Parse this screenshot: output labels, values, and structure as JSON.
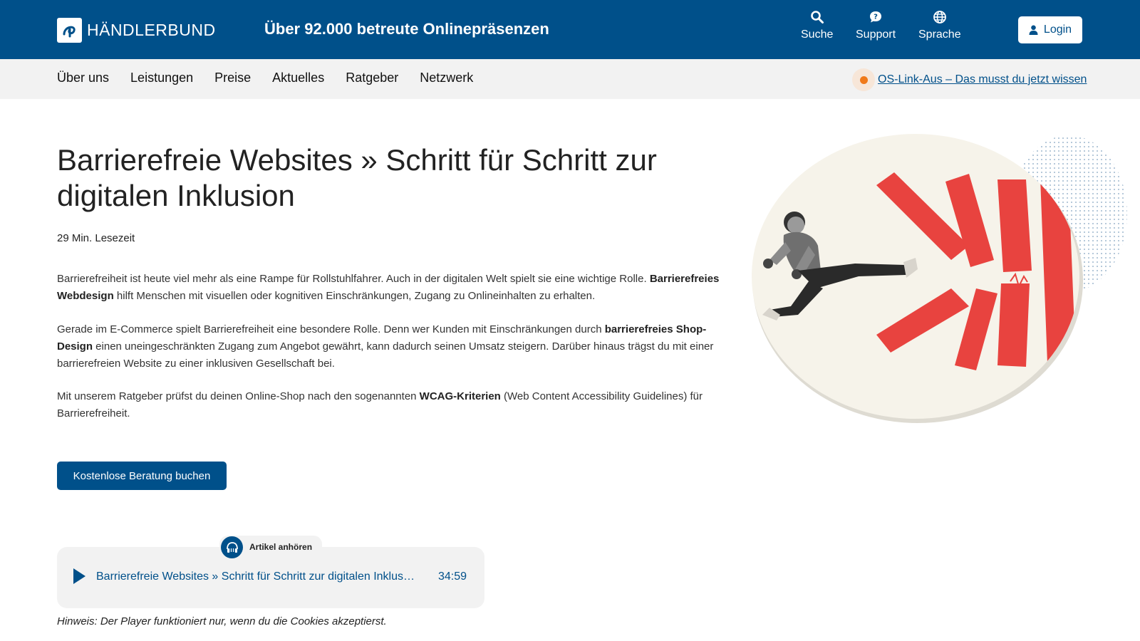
{
  "header": {
    "logo_text": "HÄNDLERBUND",
    "tagline": "Über 92.000 betreute Onlinepräsenzen",
    "utilities": {
      "search": "Suche",
      "support": "Support",
      "language": "Sprache"
    },
    "login_label": "Login"
  },
  "nav": {
    "items": [
      "Über uns",
      "Leistungen",
      "Preise",
      "Aktuelles",
      "Ratgeber",
      "Netzwerk"
    ],
    "notice": "OS-Link-Aus – Das musst du jetzt wissen"
  },
  "article": {
    "title": "Barrierefreie Websites » Schritt für Schritt zur digitalen Inklusion",
    "read_time": "29 Min. Lesezeit",
    "p1_a": "Barrierefreiheit ist heute viel mehr als eine Rampe für Rollstuhlfahrer. Auch in der digitalen Welt spielt sie eine wichtige Rolle.",
    "p1_b": "Barrierefreies Webdesign",
    "p1_c": " hilft Menschen mit visuellen oder kognitiven Einschränkungen, Zugang zu Onlineinhalten zu erhalten.",
    "p2_a": "Gerade im E-Commerce spielt Barrierefreiheit eine besondere Rolle. Denn wer Kunden mit Einschränkungen durch ",
    "p2_b": "barrierefreies Shop-Design",
    "p2_c": " einen uneingeschränkten Zugang zum Angebot gewährt, kann dadurch seinen Umsatz steigern. Darüber hinaus trägst du mit einer barrierefreien Website zu einer inklusiven Gesellschaft bei.",
    "p3_a": "Mit unserem Ratgeber prüfst du deinen Online-Shop nach den sogenannten ",
    "p3_b": "WCAG-Kriterien",
    "p3_c": " (Web Content Accessibility Guidelines) für Barrierefreiheit.",
    "cta_label": "Kostenlose Beratung buchen"
  },
  "player": {
    "tab_label": "Artikel anhören",
    "track_title": "Barrierefreie Websites » Schritt für Schritt zur digitalen Inklusion",
    "duration": "34:59",
    "hint": "Hinweis: Der Player funktioniert nur, wenn du die Cookies akzeptierst."
  },
  "icons": {
    "search": "search-icon",
    "support": "chat-question-icon",
    "language": "globe-icon",
    "login": "user-icon",
    "headphones": "headphones-icon",
    "play": "play-icon"
  },
  "colors": {
    "brand": "#00508a",
    "accent": "#f07a1a",
    "illustration_red": "#e8433f"
  }
}
